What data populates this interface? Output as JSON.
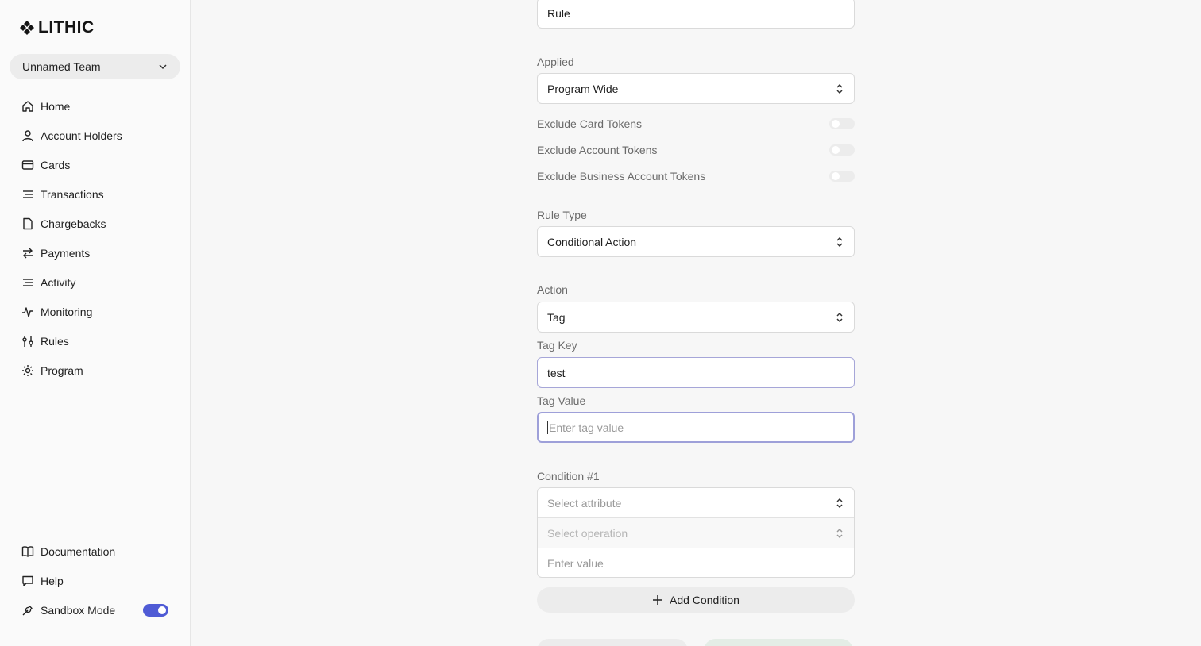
{
  "brand": {
    "name": "LITHIC"
  },
  "team": {
    "label": "Unnamed Team"
  },
  "nav": {
    "items": [
      {
        "label": "Home",
        "icon": "home-icon"
      },
      {
        "label": "Account Holders",
        "icon": "user-icon"
      },
      {
        "label": "Cards",
        "icon": "card-icon"
      },
      {
        "label": "Transactions",
        "icon": "list-icon"
      },
      {
        "label": "Chargebacks",
        "icon": "file-icon"
      },
      {
        "label": "Payments",
        "icon": "arrows-icon"
      },
      {
        "label": "Activity",
        "icon": "list-icon"
      },
      {
        "label": "Monitoring",
        "icon": "pulse-icon"
      },
      {
        "label": "Rules",
        "icon": "sliders-icon"
      },
      {
        "label": "Program",
        "icon": "gear-icon"
      }
    ],
    "bottom": [
      {
        "label": "Documentation",
        "icon": "book-icon"
      },
      {
        "label": "Help",
        "icon": "chat-icon"
      },
      {
        "label": "Sandbox Mode",
        "icon": "wrench-icon",
        "toggle_on": true
      }
    ]
  },
  "form": {
    "name_value": "Rule",
    "applied_label": "Applied",
    "applied_value": "Program Wide",
    "exclude": [
      {
        "label": "Exclude Card Tokens",
        "on": false
      },
      {
        "label": "Exclude Account Tokens",
        "on": false
      },
      {
        "label": "Exclude Business Account Tokens",
        "on": false
      }
    ],
    "rule_type_label": "Rule Type",
    "rule_type_value": "Conditional Action",
    "action_label": "Action",
    "action_value": "Tag",
    "tag_key_label": "Tag Key",
    "tag_key_value": "test",
    "tag_value_label": "Tag Value",
    "tag_value_placeholder": "Enter tag value",
    "condition_label": "Condition #1",
    "attribute_placeholder": "Select attribute",
    "operation_placeholder": "Select operation",
    "value_placeholder": "Enter value",
    "add_condition_label": "Add Condition"
  },
  "colors": {
    "accent": "#4f5bd5",
    "background": "#f7f7f7",
    "sidebar": "#fafafa"
  }
}
